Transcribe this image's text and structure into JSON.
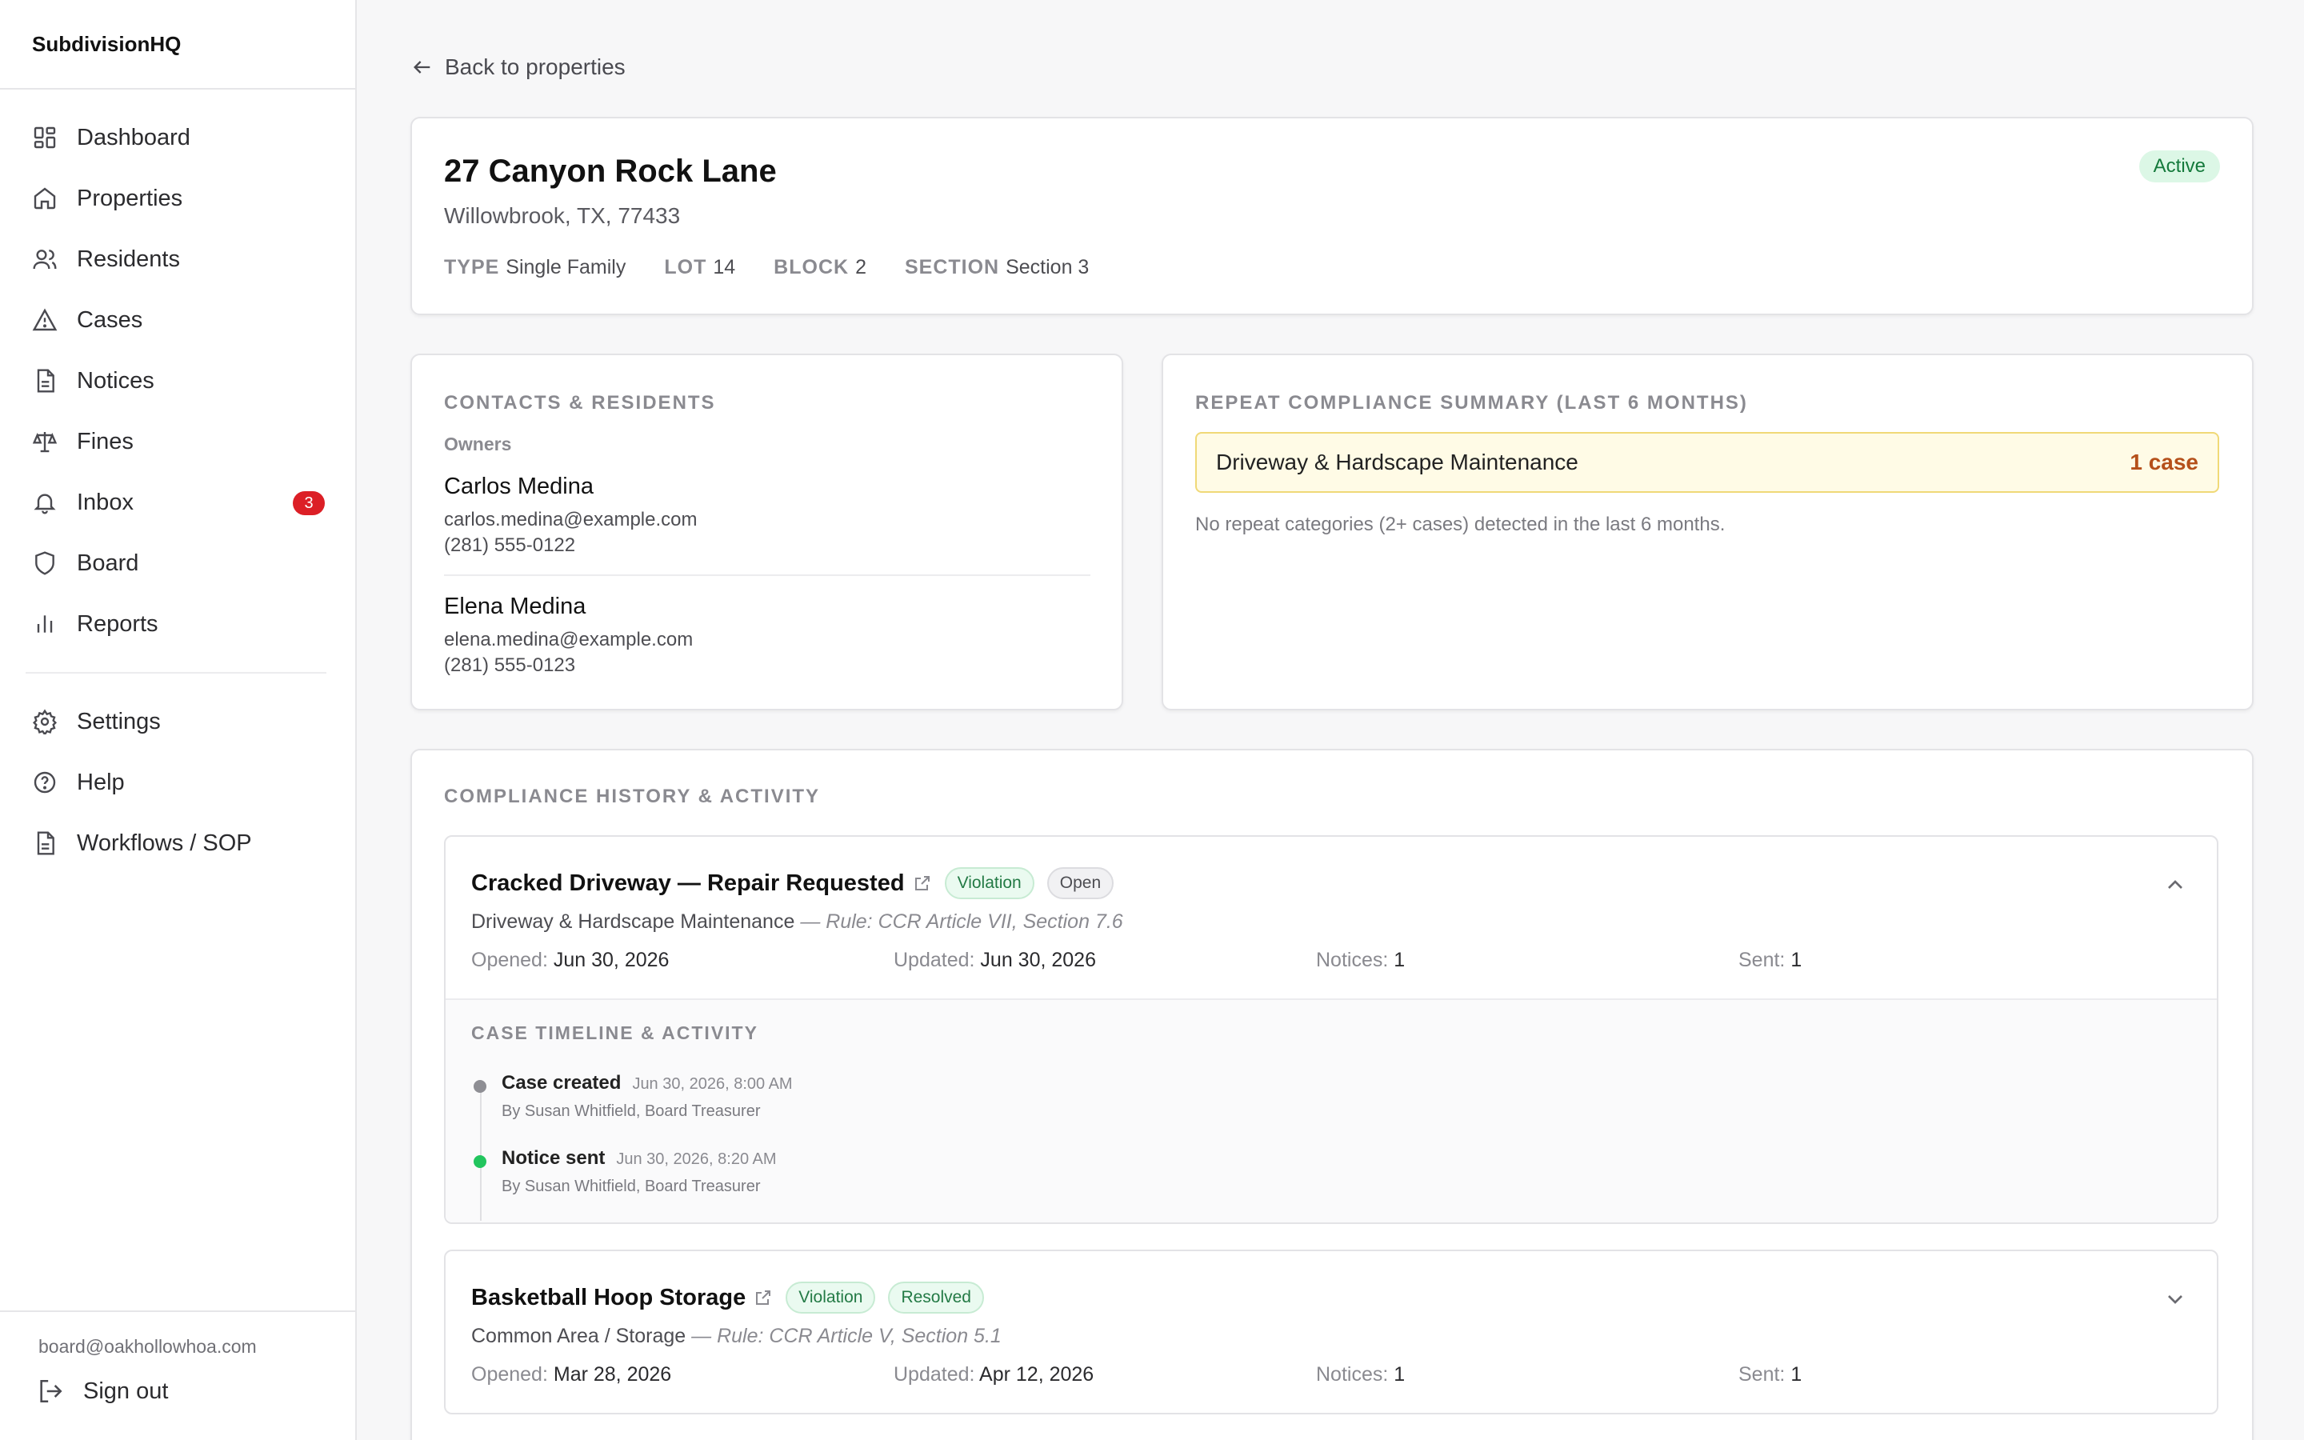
{
  "app": {
    "name": "SubdivisionHQ"
  },
  "sidebar": {
    "items": [
      {
        "label": "Dashboard",
        "icon": "dashboard-icon"
      },
      {
        "label": "Properties",
        "icon": "home-icon"
      },
      {
        "label": "Residents",
        "icon": "users-icon"
      },
      {
        "label": "Cases",
        "icon": "warning-icon"
      },
      {
        "label": "Notices",
        "icon": "document-icon"
      },
      {
        "label": "Fines",
        "icon": "scale-icon"
      },
      {
        "label": "Inbox",
        "icon": "bell-icon",
        "badge": "3"
      },
      {
        "label": "Board",
        "icon": "shield-icon"
      },
      {
        "label": "Reports",
        "icon": "bar-chart-icon"
      }
    ],
    "secondary": [
      {
        "label": "Settings",
        "icon": "gear-icon"
      },
      {
        "label": "Help",
        "icon": "help-icon"
      },
      {
        "label": "Workflows / SOP",
        "icon": "document-icon"
      }
    ],
    "user_email": "board@oakhollowhoa.com",
    "signout_label": "Sign out"
  },
  "back_label": "Back to properties",
  "property": {
    "title": "27 Canyon Rock Lane",
    "address": "Willowbrook, TX, 77433",
    "status": "Active",
    "meta": [
      {
        "key": "TYPE",
        "value": "Single Family"
      },
      {
        "key": "LOT",
        "value": "14"
      },
      {
        "key": "BLOCK",
        "value": "2"
      },
      {
        "key": "SECTION",
        "value": "Section 3"
      }
    ]
  },
  "contacts": {
    "heading": "CONTACTS & RESIDENTS",
    "owners_label": "Owners",
    "owners": [
      {
        "name": "Carlos Medina",
        "email": "carlos.medina@example.com",
        "phone": "(281) 555-0122"
      },
      {
        "name": "Elena Medina",
        "email": "elena.medina@example.com",
        "phone": "(281) 555-0123"
      }
    ]
  },
  "repeat": {
    "heading": "REPEAT COMPLIANCE SUMMARY (LAST 6 MONTHS)",
    "rows": [
      {
        "category": "Driveway & Hardscape Maintenance",
        "count": "1 case"
      }
    ],
    "note": "No repeat categories (2+ cases) detected in the last 6 months."
  },
  "history": {
    "heading": "COMPLIANCE HISTORY & ACTIVITY",
    "cases": [
      {
        "title": "Cracked Driveway — Repair Requested",
        "tags": [
          "Violation",
          "Open"
        ],
        "category": "Driveway & Hardscape Maintenance",
        "rule": "— Rule: CCR Article VII, Section 7.6",
        "opened_label": "Opened:",
        "opened": "Jun 30, 2026",
        "updated_label": "Updated:",
        "updated": "Jun 30, 2026",
        "notices_label": "Notices:",
        "notices": "1",
        "sent_label": "Sent:",
        "sent": "1",
        "timeline_heading": "CASE TIMELINE & ACTIVITY",
        "timeline": [
          {
            "event": "Case created",
            "time": "Jun 30, 2026, 8:00 AM",
            "by": "By Susan Whitfield, Board Treasurer",
            "dot_color": "#8e8e94"
          },
          {
            "event": "Notice sent",
            "time": "Jun 30, 2026, 8:20 AM",
            "by": "By Susan Whitfield, Board Treasurer",
            "dot_color": "#22c55e"
          }
        ]
      },
      {
        "title": "Basketball Hoop Storage",
        "tags": [
          "Violation",
          "Resolved"
        ],
        "category": "Common Area / Storage",
        "rule": "— Rule: CCR Article V, Section 5.1",
        "opened_label": "Opened:",
        "opened": "Mar 28, 2026",
        "updated_label": "Updated:",
        "updated": "Apr 12, 2026",
        "notices_label": "Notices:",
        "notices": "1",
        "sent_label": "Sent:",
        "sent": "1"
      }
    ]
  },
  "colors": {
    "accent_badge": "#dc1f26",
    "active_green": "#157a3c",
    "warning_bg": "#fffbe6"
  }
}
